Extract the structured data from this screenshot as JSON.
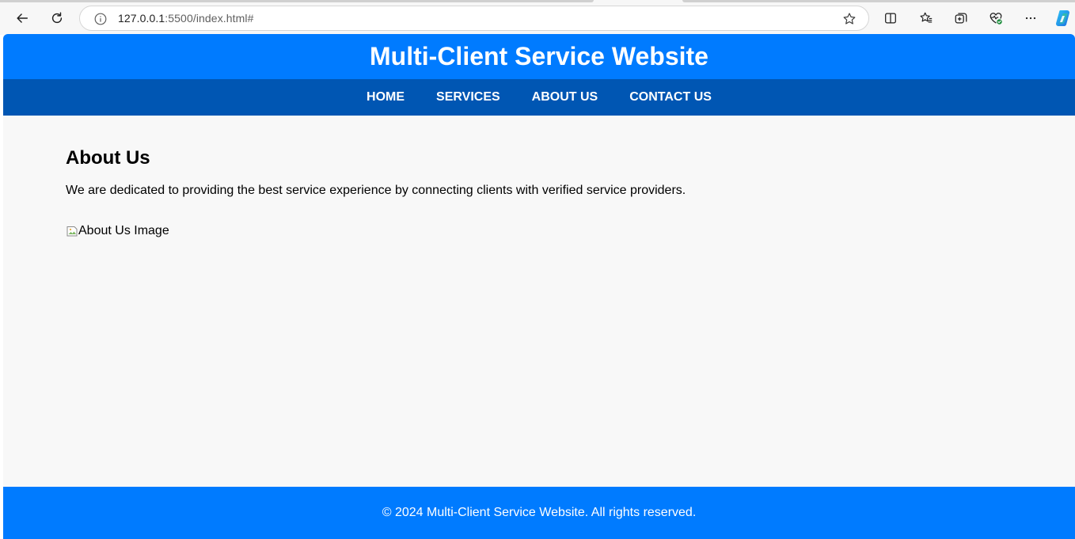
{
  "browser": {
    "url_host": "127.0.0.1",
    "url_rest": ":5500/index.html#",
    "icons": {
      "back": "back-arrow-icon",
      "reload": "reload-icon",
      "info": "site-info-icon",
      "favorite": "star-icon",
      "split_screen": "split-screen-icon",
      "favorites": "favorites-icon",
      "collections": "collections-icon",
      "browser_essentials": "heart-pulse-icon",
      "more": "more-icon",
      "copilot": "copilot-icon"
    }
  },
  "site": {
    "title": "Multi-Client Service Website",
    "nav": [
      "HOME",
      "SERVICES",
      "ABOUT US",
      "CONTACT US"
    ],
    "about": {
      "heading": "About Us",
      "text": "We are dedicated to providing the best service experience by connecting clients with verified service providers.",
      "image_alt": "About Us Image"
    },
    "footer": "© 2024 Multi-Client Service Website. All rights reserved."
  },
  "colors": {
    "header_blue": "#007bff",
    "nav_blue": "#0056b3",
    "page_bg": "#f8f8f8"
  }
}
